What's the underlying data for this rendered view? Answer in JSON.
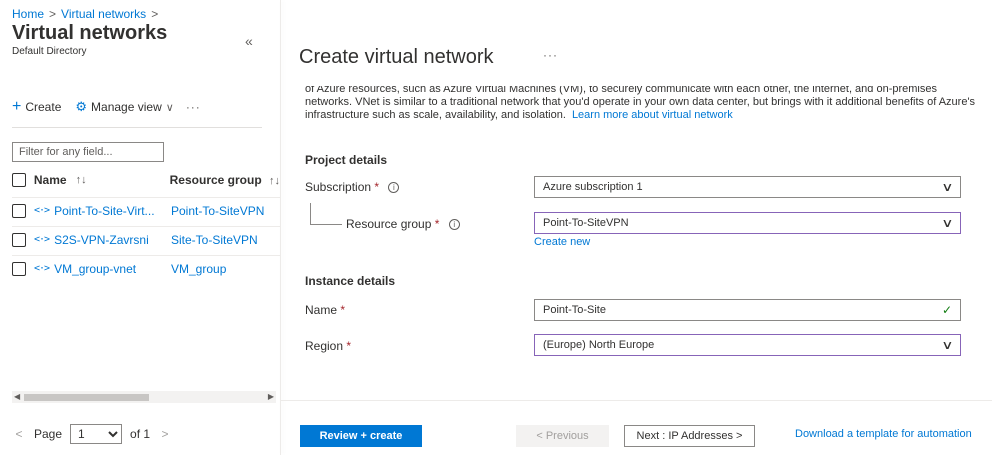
{
  "breadcrumb": {
    "home": "Home",
    "sep": ">",
    "current": "Virtual networks"
  },
  "left_pane": {
    "title": "Virtual networks",
    "subtitle": "Default Directory",
    "collapse_icon": "«",
    "toolbar": {
      "create_label": "Create",
      "manage_view_label": "Manage view",
      "more_label": "···"
    },
    "filter_placeholder": "Filter for any field...",
    "columns": {
      "name": "Name",
      "resource_group": "Resource group"
    },
    "rows": [
      {
        "name": "Point-To-Site-Virt...",
        "resource_group": "Point-To-SiteVPN"
      },
      {
        "name": "S2S-VPN-Zavrsni",
        "resource_group": "Site-To-SiteVPN"
      },
      {
        "name": "VM_group-vnet",
        "resource_group": "VM_group"
      }
    ],
    "pager": {
      "page_label": "Page",
      "current_page": "1",
      "of_label": "of 1"
    }
  },
  "blade": {
    "title": "Create virtual network",
    "more_label": "···",
    "intro_text": "of Azure resources, such as Azure Virtual Machines (VM), to securely communicate with each other, the internet, and on-premises networks. VNet is similar to a traditional network that you'd operate in your own data center, but brings with it additional benefits of Azure's infrastructure such as scale, availability, and isolation.",
    "learn_more_link": "Learn more about virtual network",
    "project_details": {
      "heading": "Project details",
      "subscription_label": "Subscription",
      "subscription_value": "Azure subscription 1",
      "resource_group_label": "Resource group",
      "resource_group_value": "Point-To-SiteVPN",
      "create_new_link": "Create new"
    },
    "instance_details": {
      "heading": "Instance details",
      "name_label": "Name",
      "name_value": "Point-To-Site",
      "region_label": "Region",
      "region_value": "(Europe) North Europe"
    },
    "footer": {
      "review_create": "Review + create",
      "previous": "< Previous",
      "next": "Next : IP Addresses >",
      "download_link": "Download a template for automation"
    }
  },
  "colors": {
    "accent": "#0078d4",
    "required": "#a4262c",
    "focus_border": "#8764b8",
    "valid": "#107c10"
  }
}
